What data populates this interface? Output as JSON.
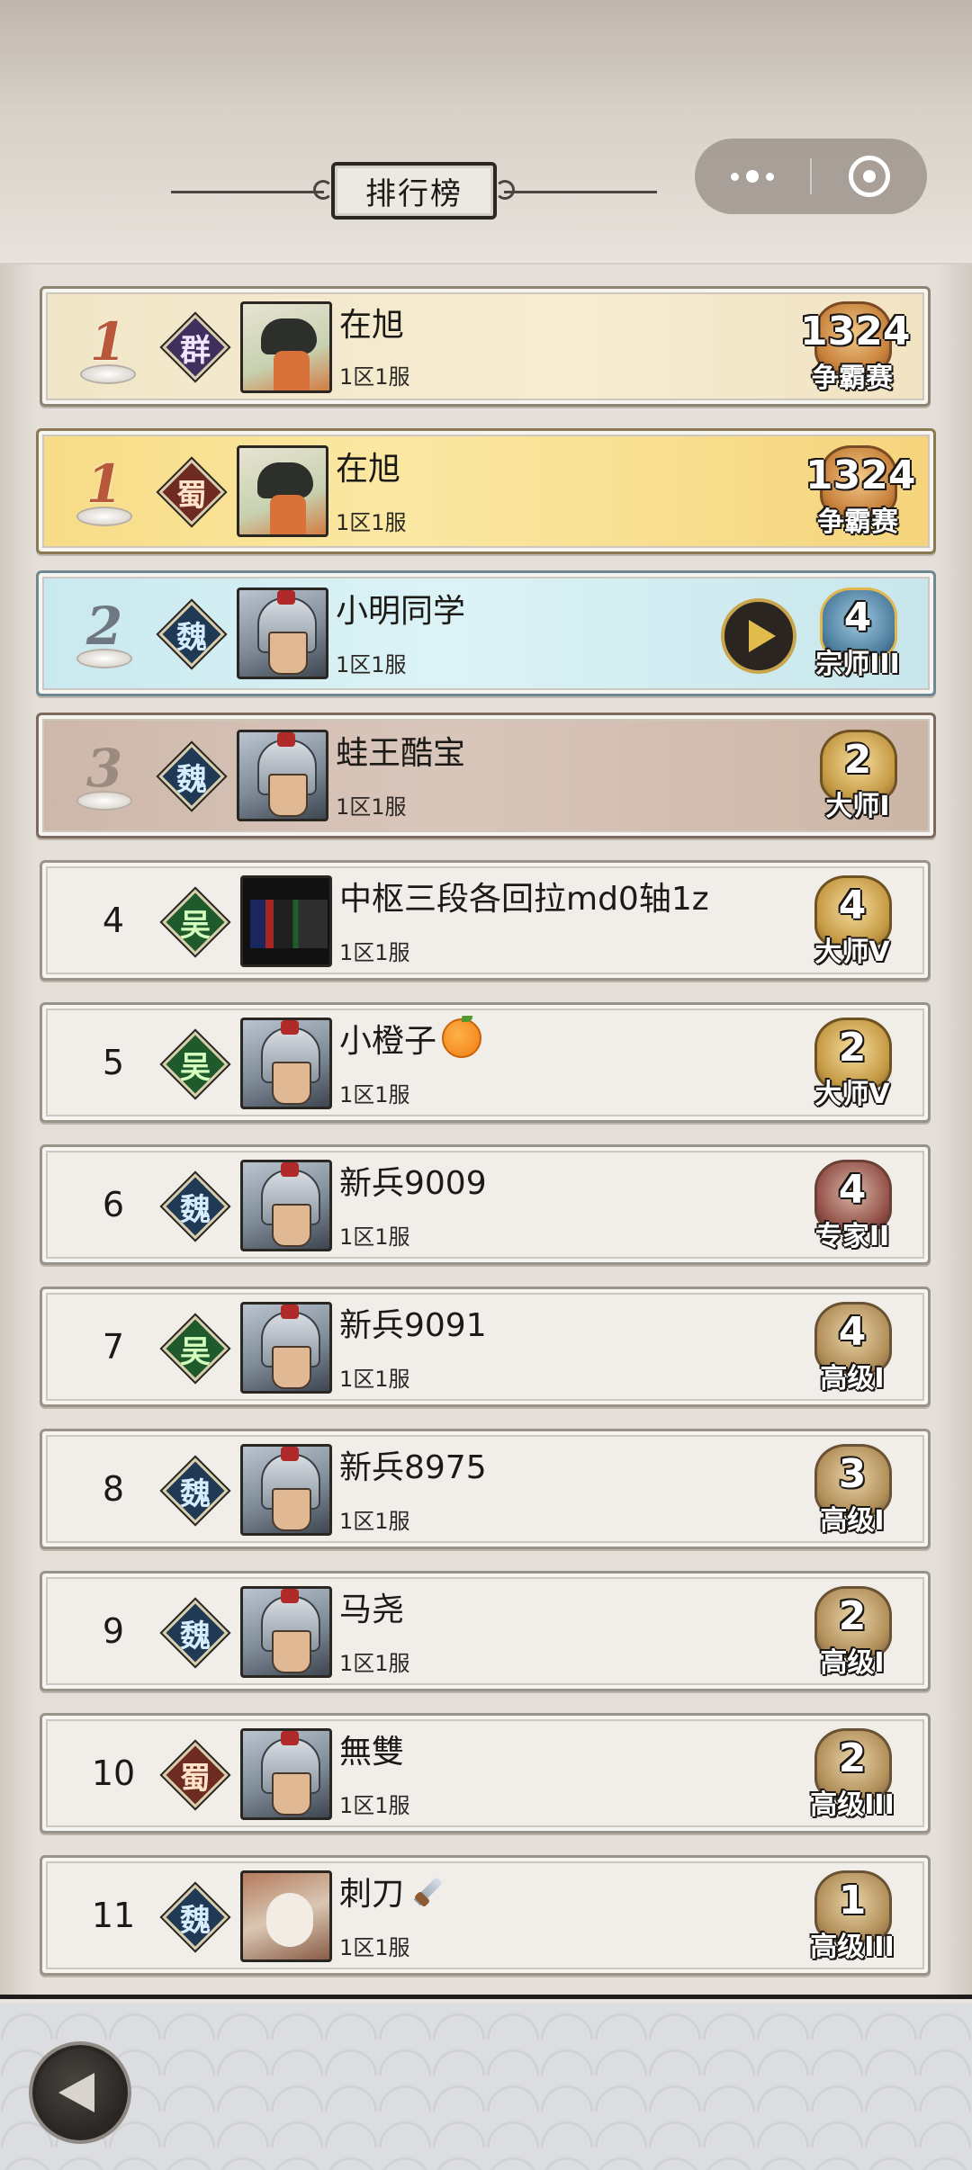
{
  "header": {
    "title": "排行榜"
  },
  "rows": [
    {
      "rank": "1",
      "faction": "群",
      "name": "在旭",
      "server": "1区1服",
      "level": "1324",
      "tier": "争霸赛"
    },
    {
      "rank": "1",
      "faction": "蜀",
      "name": "在旭",
      "server": "1区1服",
      "level": "1324",
      "tier": "争霸赛"
    },
    {
      "rank": "2",
      "faction": "魏",
      "name": "小明同学",
      "server": "1区1服",
      "level": "4",
      "tier": "宗师III"
    },
    {
      "rank": "3",
      "faction": "魏",
      "name": "蛙王酷宝",
      "server": "1区1服",
      "level": "2",
      "tier": "大师I"
    },
    {
      "rank": "4",
      "faction": "吴",
      "name": "中枢三段各回拉md0轴1z",
      "server": "1区1服",
      "level": "4",
      "tier": "大师V"
    },
    {
      "rank": "5",
      "faction": "吴",
      "name": "小橙子",
      "server": "1区1服",
      "level": "2",
      "tier": "大师V"
    },
    {
      "rank": "6",
      "faction": "魏",
      "name": "新兵9009",
      "server": "1区1服",
      "level": "4",
      "tier": "专家II"
    },
    {
      "rank": "7",
      "faction": "吴",
      "name": "新兵9091",
      "server": "1区1服",
      "level": "4",
      "tier": "高级I"
    },
    {
      "rank": "8",
      "faction": "魏",
      "name": "新兵8975",
      "server": "1区1服",
      "level": "3",
      "tier": "高级I"
    },
    {
      "rank": "9",
      "faction": "魏",
      "name": "马尧",
      "server": "1区1服",
      "level": "2",
      "tier": "高级I"
    },
    {
      "rank": "10",
      "faction": "蜀",
      "name": "無雙",
      "server": "1区1服",
      "level": "2",
      "tier": "高级III"
    },
    {
      "rank": "11",
      "faction": "魏",
      "name": "刺刀",
      "server": "1区1服",
      "level": "1",
      "tier": "高级III"
    }
  ]
}
